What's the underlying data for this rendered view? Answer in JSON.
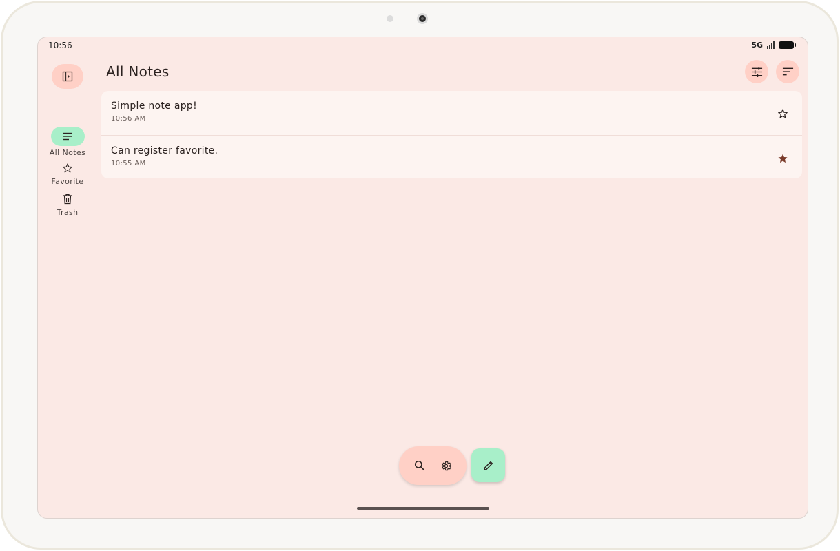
{
  "status_bar": {
    "time": "10:56",
    "network": "5G"
  },
  "nav_rail": {
    "items": [
      {
        "label": "All Notes",
        "icon": "notes-list-icon",
        "active": true
      },
      {
        "label": "Favorite",
        "icon": "star-outline-icon",
        "active": false
      },
      {
        "label": "Trash",
        "icon": "trash-icon",
        "active": false
      }
    ]
  },
  "header": {
    "title": "All Notes"
  },
  "notes": [
    {
      "title": "Simple note app!",
      "time": "10:56 AM",
      "favorite": false
    },
    {
      "title": "Can register favorite.",
      "time": "10:55 AM",
      "favorite": true
    }
  ],
  "colors": {
    "background": "#fbe9e5",
    "accent_salmon": "#ffd0c6",
    "accent_mint": "#a8efc9",
    "favorite_star": "#7a3b2a"
  }
}
